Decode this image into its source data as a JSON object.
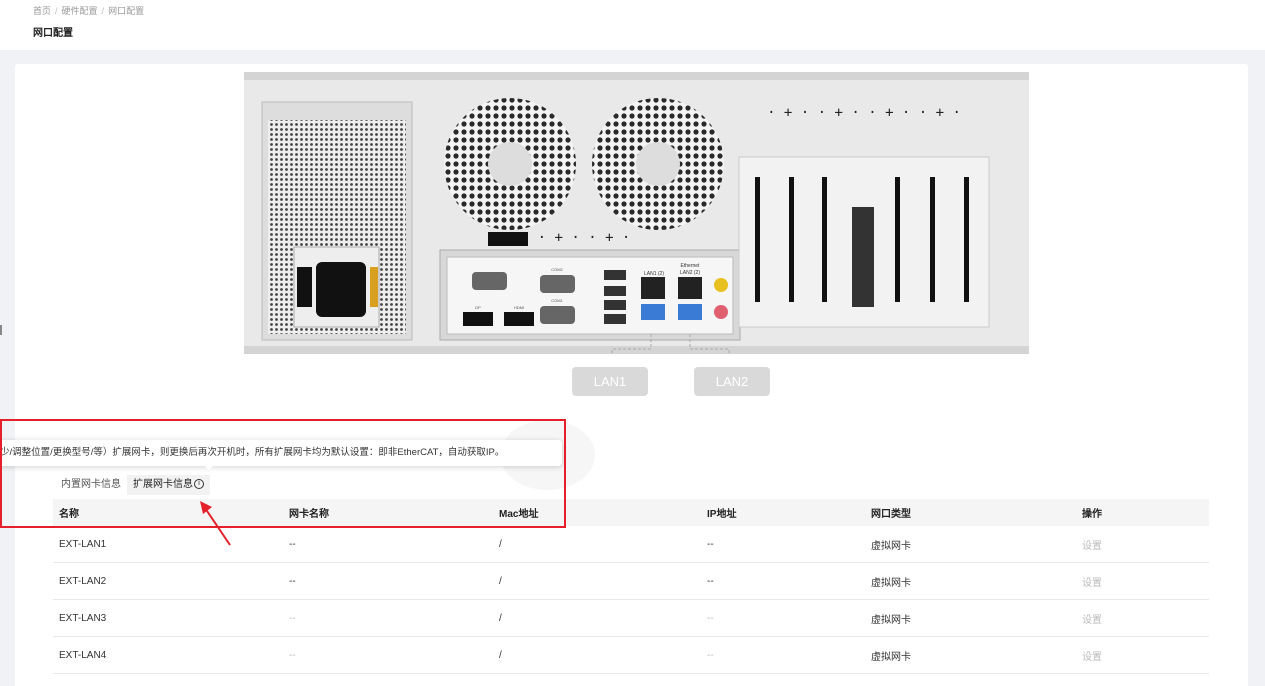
{
  "breadcrumb": {
    "items": [
      "首页",
      "硬件配置",
      "网口配置"
    ],
    "separator": "/"
  },
  "page": {
    "title": "网口配置"
  },
  "device": {
    "lan_labels": [
      "LAN1",
      "LAN2"
    ],
    "port_labels": {
      "lan1_top": "LAN1 (2)",
      "ethernet": "Ethernet",
      "lan2_top": "LAN2 (2)",
      "com2": "COM2",
      "com1": "COM1",
      "dp": "DP",
      "hdmi": "HDMI"
    }
  },
  "tooltip": {
    "text": "少/调整位置/更换型号/等）扩展网卡，则更换后再次开机时，所有扩展网卡均为默认设置：即非EtherCAT，自动获取IP。"
  },
  "tabs": [
    {
      "label": "内置网卡信息",
      "active": false
    },
    {
      "label": "扩展网卡信息",
      "active": true,
      "icon": "info-icon",
      "icon_glyph": "i"
    }
  ],
  "table": {
    "headers": [
      "名称",
      "网卡名称",
      "Mac地址",
      "IP地址",
      "网口类型",
      "操作"
    ],
    "rows": [
      {
        "name": "EXT-LAN1",
        "nic": "--",
        "mac": "/",
        "ip": "--",
        "type": "虚拟网卡",
        "action": "设置"
      },
      {
        "name": "EXT-LAN2",
        "nic": "--",
        "mac": "/",
        "ip": "--",
        "type": "虚拟网卡",
        "action": "设置"
      },
      {
        "name": "EXT-LAN3",
        "nic": "--",
        "mac": "/",
        "ip": "--",
        "type": "虚拟网卡",
        "action": "设置"
      },
      {
        "name": "EXT-LAN4",
        "nic": "--",
        "mac": "/",
        "ip": "--",
        "type": "虚拟网卡",
        "action": "设置"
      }
    ]
  },
  "colors": {
    "highlight": "#e5202a",
    "accent_port": "#3a7bd5",
    "background": "#f0f2f5"
  }
}
